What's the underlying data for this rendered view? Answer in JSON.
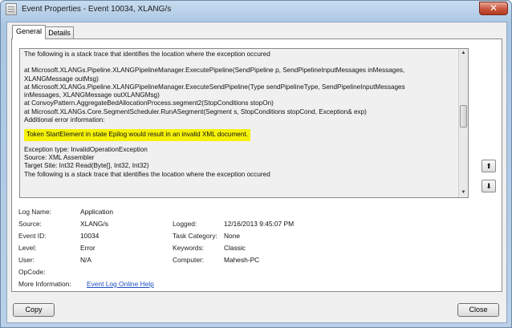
{
  "window": {
    "title": "Event Properties - Event 10034, XLANG/s",
    "close_glyph": "✕"
  },
  "tabs": [
    {
      "label": "General"
    },
    {
      "label": "Details"
    }
  ],
  "description": {
    "lines": [
      "The following is a stack trace that identifies the location where the exception occured",
      "",
      "   at Microsoft.XLANGs.Pipeline.XLANGPipelineManager.ExecutePipeline(SendPipeline p, SendPipelineInputMessages inMessages,",
      "XLANGMessage outMsg)",
      "   at Microsoft.XLANGs.Pipeline.XLANGPipelineManager.ExecuteSendPipeline(Type sendPipelineType, SendPipelineInputMessages",
      "inMessages, XLANGMessage outXLANGMsg)",
      "   at ConvoyPattern.AggregateBedAllocationProcess.segment2(StopConditions stopOn)",
      "   at Microsoft.XLANGs.Core.SegmentScheduler.RunASegment(Segment s, StopConditions stopCond, Exception& exp)",
      "Additional error information:"
    ],
    "highlight": "Token StartElement in state Epilog would result in an invalid XML document.",
    "after_lines": [
      "Exception type: InvalidOperationException",
      "Source: XML Assembler",
      "Target Site: Int32 Read(Byte[], Int32, Int32)",
      "The following is a stack trace that identifies the location where the exception occured"
    ]
  },
  "scroll": {
    "up_icon": "▲",
    "down_icon": "▼"
  },
  "nav": {
    "up_icon": "⬆",
    "down_icon": "⬇"
  },
  "properties": {
    "log_name_label": "Log Name:",
    "log_name_value": "Application",
    "source_label": "Source:",
    "source_value": "XLANG/s",
    "logged_label": "Logged:",
    "logged_value": "12/16/2013 9:45:07 PM",
    "event_id_label": "Event ID:",
    "event_id_value": "10034",
    "task_category_label": "Task Category:",
    "task_category_value": "None",
    "level_label": "Level:",
    "level_value": "Error",
    "keywords_label": "Keywords:",
    "keywords_value": "Classic",
    "user_label": "User:",
    "user_value": "N/A",
    "computer_label": "Computer:",
    "computer_value": "Mahesh-PC",
    "opcode_label": "OpCode:",
    "more_info_label": "More Information:",
    "more_info_link": "Event Log Online Help"
  },
  "buttons": {
    "copy": "Copy",
    "close": "Close"
  },
  "colors": {
    "highlight": "#f5f20a",
    "link": "#1d4fc0"
  }
}
